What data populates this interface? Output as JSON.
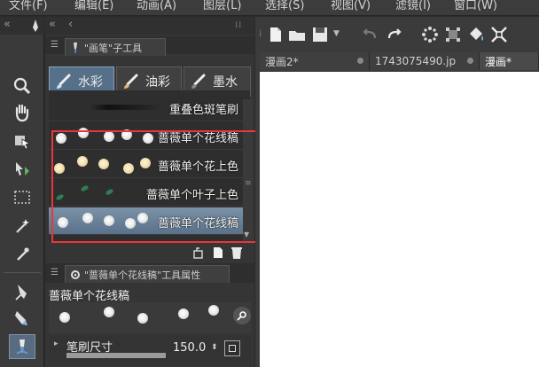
{
  "menubar": {
    "items": [
      "文件(F)",
      "编辑(E)",
      "动画(A)",
      "图层(L)",
      "选择(S)",
      "视图(V)",
      "滤镜(I)",
      "窗口(W)"
    ]
  },
  "brush_panel": {
    "header_title": "\"画笔\"子工具",
    "subtools": [
      {
        "label": "水彩",
        "active": true
      },
      {
        "label": "油彩",
        "active": false
      },
      {
        "label": "墨水",
        "active": false
      }
    ],
    "brushes": [
      {
        "label": "重叠色斑笔刷",
        "selected": false
      },
      {
        "label": "蔷薇单个花线稿",
        "selected": false
      },
      {
        "label": "蔷薇单个花上色",
        "selected": false
      },
      {
        "label": "蔷薇单个叶子上色",
        "selected": false
      },
      {
        "label": "蔷薇单个花线稿",
        "selected": true
      }
    ]
  },
  "property_panel": {
    "title": "\"蔷薇单个花线稿\"工具属性",
    "brush_name": "蔷薇单个花线稿",
    "size_label": "笔刷尺寸",
    "size_value": "150.0"
  },
  "document": {
    "tabs": [
      {
        "label": "漫画2*",
        "active": false
      },
      {
        "label": "1743075490.jp",
        "active": false
      },
      {
        "label": "漫画*",
        "active": true
      }
    ]
  },
  "colors": {
    "highlight_box": "#e8373b",
    "selected_row": "#59718a",
    "canvas": "#ffffff"
  }
}
